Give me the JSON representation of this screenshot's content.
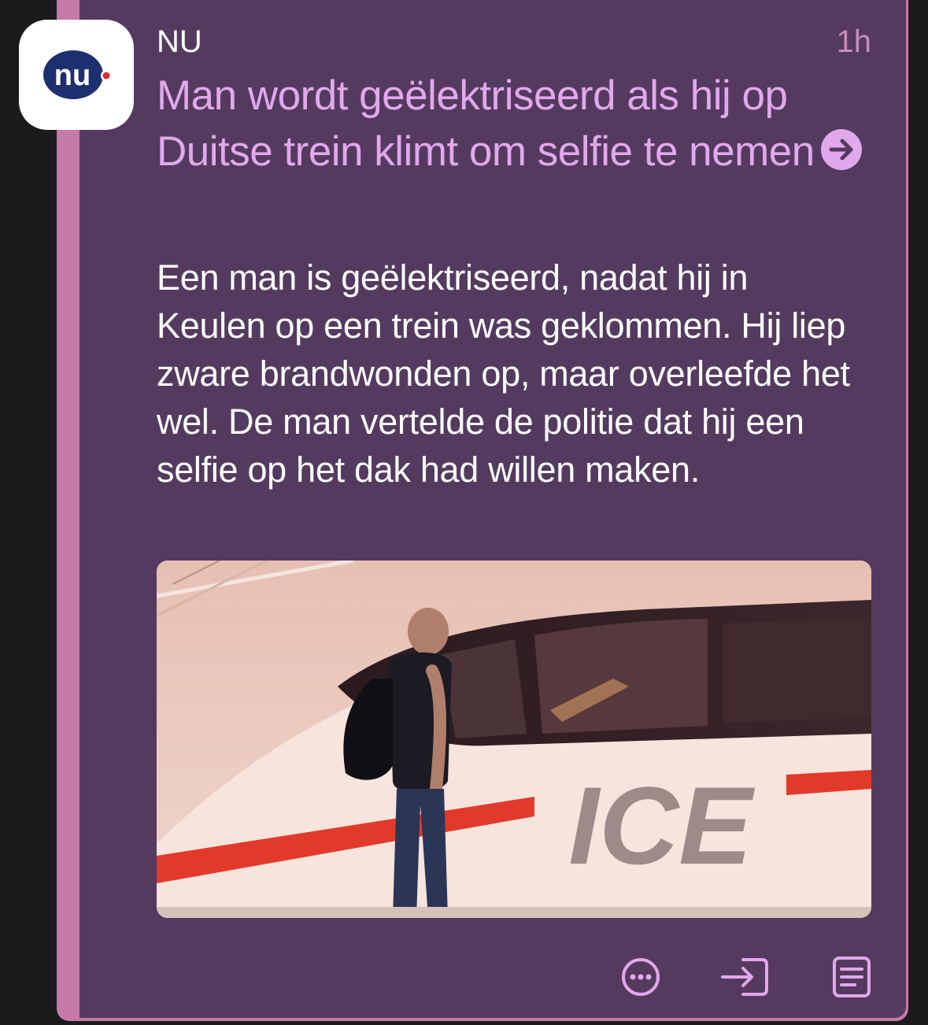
{
  "post": {
    "source": "NU",
    "time": "1h",
    "headline": "Man wordt geëlektriseerd als hij op Duitse trein klimt om selfie te nemen",
    "summary": "Een man is geëlektriseerd, nadat hij in Keulen op een trein was geklommen. Hij liep zware brandwonden op, maar overleefde het wel. De man vertelde de politie dat hij een selfie op het dak had willen maken.",
    "image_text": "ICE"
  },
  "logo": {
    "text": "nu"
  },
  "actions": [
    "more-icon",
    "open-icon",
    "reader-icon"
  ],
  "colors": {
    "card_bg": "#553a60",
    "accent_bar": "#c67aa9",
    "headline": "#e1a8ec",
    "time": "#c98bb8",
    "icon": "#e1a8ec"
  }
}
